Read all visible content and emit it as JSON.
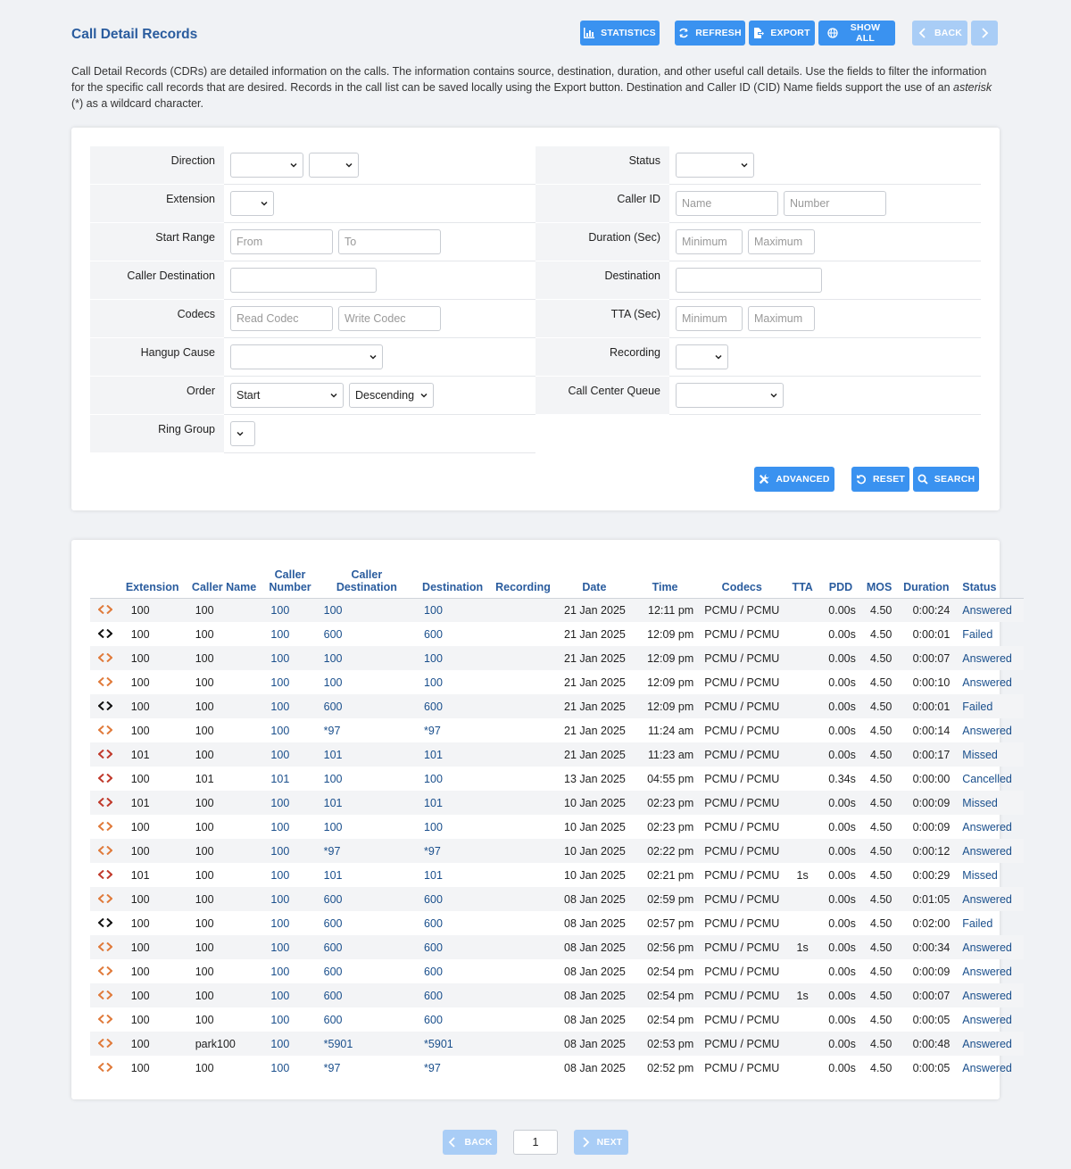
{
  "header": {
    "title": "Call Detail Records",
    "buttons": {
      "statistics": "Statistics",
      "refresh": "Refresh",
      "export": "Export",
      "show_all": "Show All",
      "back": "Back"
    }
  },
  "intro": {
    "text_1": "Call Detail Records (CDRs) are detailed information on the calls. The information contains source, destination, duration, and other useful call details. Use the fields to filter the information for the specific call records that are desired. Records in the call list can be saved locally using the Export button.   Destination and Caller ID (CID) Name fields support the use of an ",
    "emph": "asterisk",
    "text_2": " (*) as a wildcard character."
  },
  "filters": {
    "direction": {
      "label": "Direction"
    },
    "extension": {
      "label": "Extension"
    },
    "start_range": {
      "label": "Start Range",
      "from_placeholder": "From",
      "to_placeholder": "To"
    },
    "caller_destination": {
      "label": "Caller Destination"
    },
    "codecs": {
      "label": "Codecs",
      "read_placeholder": "Read Codec",
      "write_placeholder": "Write Codec"
    },
    "hangup_cause": {
      "label": "Hangup Cause"
    },
    "order": {
      "label": "Order",
      "field_value": "Start",
      "direction_value": "Descending"
    },
    "ring_group": {
      "label": "Ring Group"
    },
    "status": {
      "label": "Status"
    },
    "caller_id": {
      "label": "Caller ID",
      "name_placeholder": "Name",
      "number_placeholder": "Number"
    },
    "duration": {
      "label": "Duration (Sec)",
      "min_placeholder": "Minimum",
      "max_placeholder": "Maximum"
    },
    "destination": {
      "label": "Destination"
    },
    "tta": {
      "label": "TTA (Sec)",
      "min_placeholder": "Minimum",
      "max_placeholder": "Maximum"
    },
    "recording": {
      "label": "Recording"
    },
    "call_center_queue": {
      "label": "Call Center Queue"
    },
    "buttons": {
      "advanced": "Advanced",
      "reset": "Reset",
      "search": "Search"
    }
  },
  "table": {
    "columns": {
      "extension": "Extension",
      "caller_name": "Caller Name",
      "caller_number_1": "Caller",
      "caller_number_2": "Number",
      "caller_destination": "Caller Destination",
      "destination": "Destination",
      "recording": "Recording",
      "date": "Date",
      "time": "Time",
      "codecs": "Codecs",
      "tta": "TTA",
      "pdd": "PDD",
      "mos": "MOS",
      "duration": "Duration",
      "status": "Status"
    },
    "rows": [
      {
        "dir": "answered",
        "ext": "100",
        "cname": "100",
        "cnum": "100",
        "cdest": "100",
        "dest": "100",
        "date": "21 Jan 2025",
        "time": "12:11 pm",
        "codecs": "PCMU / PCMU",
        "tta": "",
        "pdd": "0.00s",
        "mos": "4.50",
        "dur": "0:00:24",
        "status": "Answered"
      },
      {
        "dir": "failed",
        "ext": "100",
        "cname": "100",
        "cnum": "100",
        "cdest": "600",
        "dest": "600",
        "date": "21 Jan 2025",
        "time": "12:09 pm",
        "codecs": "PCMU / PCMU",
        "tta": "",
        "pdd": "0.00s",
        "mos": "4.50",
        "dur": "0:00:01",
        "status": "Failed"
      },
      {
        "dir": "answered",
        "ext": "100",
        "cname": "100",
        "cnum": "100",
        "cdest": "100",
        "dest": "100",
        "date": "21 Jan 2025",
        "time": "12:09 pm",
        "codecs": "PCMU / PCMU",
        "tta": "",
        "pdd": "0.00s",
        "mos": "4.50",
        "dur": "0:00:07",
        "status": "Answered"
      },
      {
        "dir": "answered",
        "ext": "100",
        "cname": "100",
        "cnum": "100",
        "cdest": "100",
        "dest": "100",
        "date": "21 Jan 2025",
        "time": "12:09 pm",
        "codecs": "PCMU / PCMU",
        "tta": "",
        "pdd": "0.00s",
        "mos": "4.50",
        "dur": "0:00:10",
        "status": "Answered"
      },
      {
        "dir": "failed",
        "ext": "100",
        "cname": "100",
        "cnum": "100",
        "cdest": "600",
        "dest": "600",
        "date": "21 Jan 2025",
        "time": "12:09 pm",
        "codecs": "PCMU / PCMU",
        "tta": "",
        "pdd": "0.00s",
        "mos": "4.50",
        "dur": "0:00:01",
        "status": "Failed"
      },
      {
        "dir": "answered",
        "ext": "100",
        "cname": "100",
        "cnum": "100",
        "cdest": "*97",
        "dest": "*97",
        "date": "21 Jan 2025",
        "time": "11:24 am",
        "codecs": "PCMU / PCMU",
        "tta": "",
        "pdd": "0.00s",
        "mos": "4.50",
        "dur": "0:00:14",
        "status": "Answered"
      },
      {
        "dir": "missed",
        "ext": "101",
        "cname": "100",
        "cnum": "100",
        "cdest": "101",
        "dest": "101",
        "date": "21 Jan 2025",
        "time": "11:23 am",
        "codecs": "PCMU / PCMU",
        "tta": "",
        "pdd": "0.00s",
        "mos": "4.50",
        "dur": "0:00:17",
        "status": "Missed"
      },
      {
        "dir": "missed",
        "ext": "100",
        "cname": "101",
        "cnum": "101",
        "cdest": "100",
        "dest": "100",
        "date": "13 Jan 2025",
        "time": "04:55 pm",
        "codecs": "PCMU / PCMU",
        "tta": "",
        "pdd": "0.34s",
        "mos": "4.50",
        "dur": "0:00:00",
        "status": "Cancelled"
      },
      {
        "dir": "missed",
        "ext": "101",
        "cname": "100",
        "cnum": "100",
        "cdest": "101",
        "dest": "101",
        "date": "10 Jan 2025",
        "time": "02:23 pm",
        "codecs": "PCMU / PCMU",
        "tta": "",
        "pdd": "0.00s",
        "mos": "4.50",
        "dur": "0:00:09",
        "status": "Missed"
      },
      {
        "dir": "answered",
        "ext": "100",
        "cname": "100",
        "cnum": "100",
        "cdest": "100",
        "dest": "100",
        "date": "10 Jan 2025",
        "time": "02:23 pm",
        "codecs": "PCMU / PCMU",
        "tta": "",
        "pdd": "0.00s",
        "mos": "4.50",
        "dur": "0:00:09",
        "status": "Answered"
      },
      {
        "dir": "answered",
        "ext": "100",
        "cname": "100",
        "cnum": "100",
        "cdest": "*97",
        "dest": "*97",
        "date": "10 Jan 2025",
        "time": "02:22 pm",
        "codecs": "PCMU / PCMU",
        "tta": "",
        "pdd": "0.00s",
        "mos": "4.50",
        "dur": "0:00:12",
        "status": "Answered"
      },
      {
        "dir": "missed",
        "ext": "101",
        "cname": "100",
        "cnum": "100",
        "cdest": "101",
        "dest": "101",
        "date": "10 Jan 2025",
        "time": "02:21 pm",
        "codecs": "PCMU / PCMU",
        "tta": "1s",
        "pdd": "0.00s",
        "mos": "4.50",
        "dur": "0:00:29",
        "status": "Missed"
      },
      {
        "dir": "answered",
        "ext": "100",
        "cname": "100",
        "cnum": "100",
        "cdest": "600",
        "dest": "600",
        "date": "08 Jan 2025",
        "time": "02:59 pm",
        "codecs": "PCMU / PCMU",
        "tta": "",
        "pdd": "0.00s",
        "mos": "4.50",
        "dur": "0:01:05",
        "status": "Answered"
      },
      {
        "dir": "failed",
        "ext": "100",
        "cname": "100",
        "cnum": "100",
        "cdest": "600",
        "dest": "600",
        "date": "08 Jan 2025",
        "time": "02:57 pm",
        "codecs": "PCMU / PCMU",
        "tta": "",
        "pdd": "0.00s",
        "mos": "4.50",
        "dur": "0:02:00",
        "status": "Failed"
      },
      {
        "dir": "answered",
        "ext": "100",
        "cname": "100",
        "cnum": "100",
        "cdest": "600",
        "dest": "600",
        "date": "08 Jan 2025",
        "time": "02:56 pm",
        "codecs": "PCMU / PCMU",
        "tta": "1s",
        "pdd": "0.00s",
        "mos": "4.50",
        "dur": "0:00:34",
        "status": "Answered"
      },
      {
        "dir": "answered",
        "ext": "100",
        "cname": "100",
        "cnum": "100",
        "cdest": "600",
        "dest": "600",
        "date": "08 Jan 2025",
        "time": "02:54 pm",
        "codecs": "PCMU / PCMU",
        "tta": "",
        "pdd": "0.00s",
        "mos": "4.50",
        "dur": "0:00:09",
        "status": "Answered"
      },
      {
        "dir": "answered",
        "ext": "100",
        "cname": "100",
        "cnum": "100",
        "cdest": "600",
        "dest": "600",
        "date": "08 Jan 2025",
        "time": "02:54 pm",
        "codecs": "PCMU / PCMU",
        "tta": "1s",
        "pdd": "0.00s",
        "mos": "4.50",
        "dur": "0:00:07",
        "status": "Answered"
      },
      {
        "dir": "answered",
        "ext": "100",
        "cname": "100",
        "cnum": "100",
        "cdest": "600",
        "dest": "600",
        "date": "08 Jan 2025",
        "time": "02:54 pm",
        "codecs": "PCMU / PCMU",
        "tta": "",
        "pdd": "0.00s",
        "mos": "4.50",
        "dur": "0:00:05",
        "status": "Answered"
      },
      {
        "dir": "answered",
        "ext": "100",
        "cname": "park100",
        "cnum": "100",
        "cdest": "*5901",
        "dest": "*5901",
        "date": "08 Jan 2025",
        "time": "02:53 pm",
        "codecs": "PCMU / PCMU",
        "tta": "",
        "pdd": "0.00s",
        "mos": "4.50",
        "dur": "0:00:48",
        "status": "Answered"
      },
      {
        "dir": "answered",
        "ext": "100",
        "cname": "100",
        "cnum": "100",
        "cdest": "*97",
        "dest": "*97",
        "date": "08 Jan 2025",
        "time": "02:52 pm",
        "codecs": "PCMU / PCMU",
        "tta": "",
        "pdd": "0.00s",
        "mos": "4.50",
        "dur": "0:00:05",
        "status": "Answered"
      }
    ]
  },
  "pagination": {
    "back": "Back",
    "page": "1",
    "next": "Next"
  },
  "colors": {
    "accent": "#3a92f0",
    "accent_disabled": "#a9cdf6",
    "title": "#2a5c9e",
    "link": "#1a4f8c",
    "answered_icon": "#e07a3a",
    "missed_icon": "#c0392b",
    "failed_icon": "#111111"
  }
}
